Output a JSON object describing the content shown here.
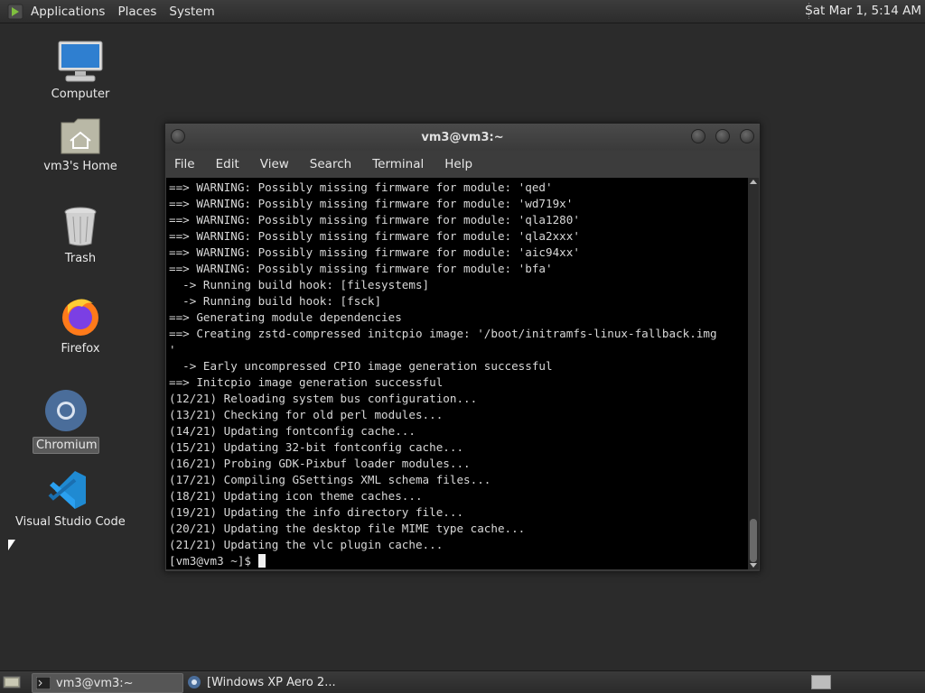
{
  "top_panel": {
    "menu": [
      "Applications",
      "Places",
      "System"
    ],
    "clock": "Sat Mar 1, 5:14 AM"
  },
  "desktop": {
    "icons": [
      {
        "label": "Computer",
        "icon": "computer-icon"
      },
      {
        "label": "vm3's Home",
        "icon": "home-folder-icon"
      },
      {
        "label": "Trash",
        "icon": "trash-icon"
      },
      {
        "label": "Firefox",
        "icon": "firefox-icon"
      },
      {
        "label": "Chromium",
        "icon": "chromium-icon"
      },
      {
        "label": "Visual Studio Code",
        "icon": "vscode-icon"
      }
    ]
  },
  "terminal": {
    "title": "vm3@vm3:~",
    "menu": [
      "File",
      "Edit",
      "View",
      "Search",
      "Terminal",
      "Help"
    ],
    "lines": [
      "==> WARNING: Possibly missing firmware for module: 'qed'",
      "==> WARNING: Possibly missing firmware for module: 'wd719x'",
      "==> WARNING: Possibly missing firmware for module: 'qla1280'",
      "==> WARNING: Possibly missing firmware for module: 'qla2xxx'",
      "==> WARNING: Possibly missing firmware for module: 'aic94xx'",
      "==> WARNING: Possibly missing firmware for module: 'bfa'",
      "  -> Running build hook: [filesystems]",
      "  -> Running build hook: [fsck]",
      "==> Generating module dependencies",
      "==> Creating zstd-compressed initcpio image: '/boot/initramfs-linux-fallback.img",
      "'",
      "  -> Early uncompressed CPIO image generation successful",
      "==> Initcpio image generation successful",
      "(12/21) Reloading system bus configuration...",
      "(13/21) Checking for old perl modules...",
      "(14/21) Updating fontconfig cache...",
      "(15/21) Updating 32-bit fontconfig cache...",
      "(16/21) Probing GDK-Pixbuf loader modules...",
      "(17/21) Compiling GSettings XML schema files...",
      "(18/21) Updating icon theme caches...",
      "(19/21) Updating the info directory file...",
      "(20/21) Updating the desktop file MIME type cache...",
      "(21/21) Updating the vlc plugin cache..."
    ],
    "prompt": "[vm3@vm3 ~]$ "
  },
  "taskbar": {
    "tasks": [
      {
        "label": "vm3@vm3:~",
        "active": true
      },
      {
        "label": "[Windows XP Aero 2...",
        "active": false
      }
    ]
  }
}
